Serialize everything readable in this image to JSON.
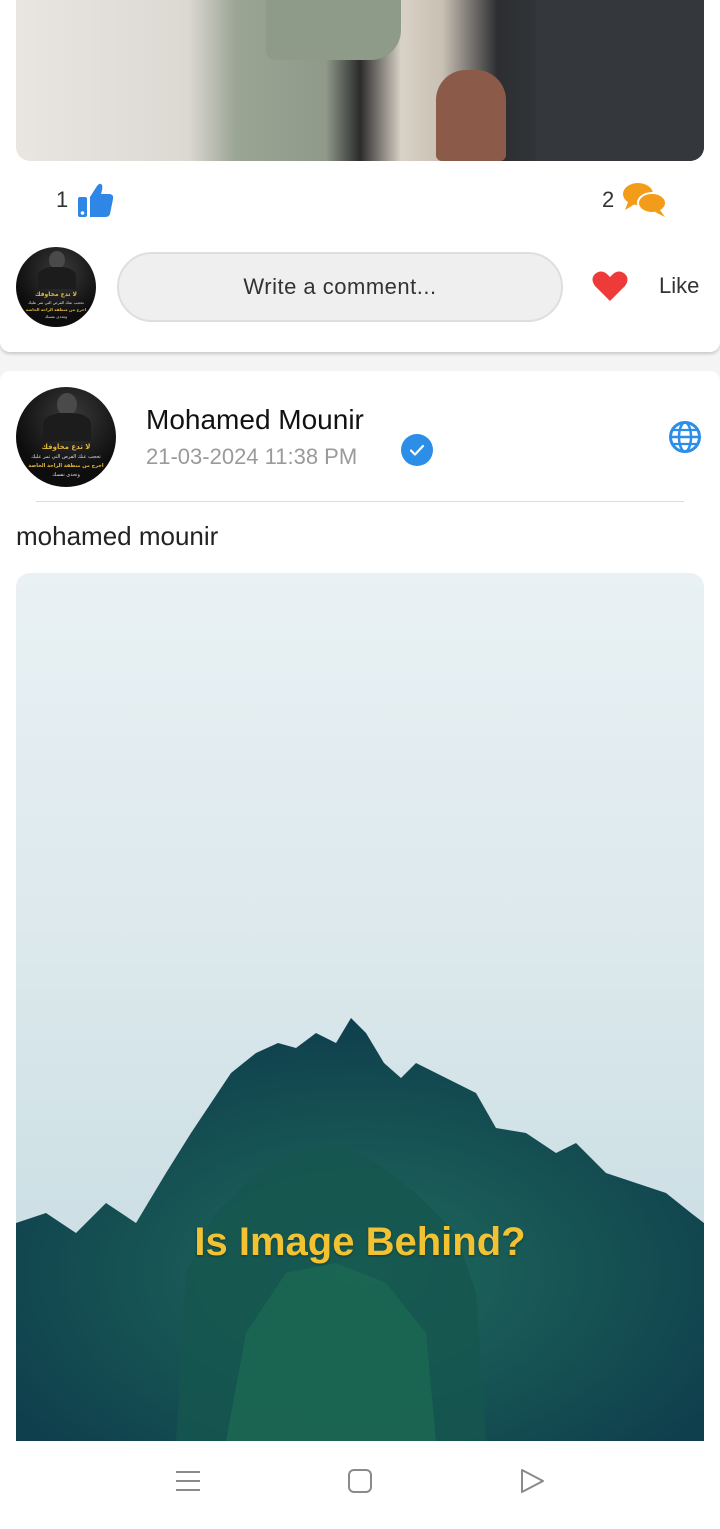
{
  "prev_post": {
    "likes_count": "1",
    "comments_count": "2",
    "comment_placeholder": "Write a comment...",
    "like_label": "Like"
  },
  "post": {
    "author": "Mohamed Mounir",
    "timestamp": "21-03-2024 11:38 PM",
    "text": "mohamed mounir",
    "image_caption": "Is Image Behind?",
    "verified": true,
    "visibility_icon": "globe-icon"
  },
  "avatar": {
    "line1": "لا تدع مخاوفك",
    "line2": "تحجب عنك الفرص التي تمر عليك",
    "line3": "اخرج من منطقة الراحة الخاصة",
    "line4": "وتحدى نفسك"
  },
  "colors": {
    "like_blue": "#2f86e6",
    "comment_orange": "#f39c1a",
    "heart_red": "#ef3a3a",
    "verified_blue": "#2d8ee8",
    "caption_yellow": "#f2c233"
  },
  "navbar": {
    "icons": [
      "menu-icon",
      "home-square-icon",
      "back-triangle-icon"
    ]
  }
}
